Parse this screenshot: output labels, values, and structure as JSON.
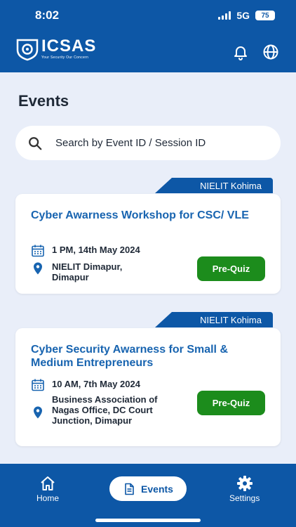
{
  "status_bar": {
    "time": "8:02",
    "network": "5G",
    "battery": "75"
  },
  "header": {
    "logo_text": "ICSAS",
    "tagline": "Your Security Our Concern"
  },
  "page": {
    "title": "Events"
  },
  "search": {
    "placeholder": "Search by Event ID / Session ID"
  },
  "events": [
    {
      "organizer": "NIELIT Kohima",
      "title": "Cyber Awarness Workshop for CSC/ VLE",
      "datetime": "1 PM, 14th May 2024",
      "location": "NIELIT Dimapur, Dimapur",
      "button_label": "Pre-Quiz"
    },
    {
      "organizer": "NIELIT Kohima",
      "title": "Cyber Security Awarness for Small & Medium Entrepreneurs",
      "datetime": "10 AM, 7th May 2024",
      "location": "Business Association of Nagas Office, DC Court Junction, Dimapur",
      "button_label": "Pre-Quiz"
    }
  ],
  "bottom_nav": {
    "home": "Home",
    "events": "Events",
    "settings": "Settings"
  },
  "colors": {
    "primary": "#0d57a6",
    "accent_green": "#1c8c1c",
    "background": "#e9eef9",
    "title_blue": "#1864b0"
  }
}
